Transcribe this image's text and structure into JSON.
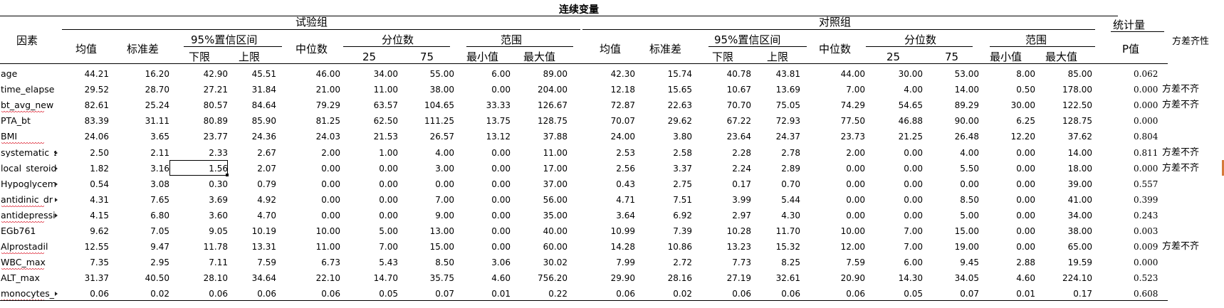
{
  "title": "连续变量",
  "groups": {
    "trial": "试验组",
    "control": "对照组",
    "stat": "统计量"
  },
  "headers": {
    "factor": "因素",
    "mean": "均值",
    "sd": "标准差",
    "ci": "95%置信区间",
    "ci_low": "下限",
    "ci_high": "上限",
    "median": "中位数",
    "quantile": "分位数",
    "q25": "25",
    "q75": "75",
    "range": "范围",
    "min": "最小值",
    "max": "最大值",
    "p": "P值",
    "var_homo": "方差齐性"
  },
  "rows": [
    {
      "name": "age",
      "t": [
        "44.21",
        "16.20",
        "42.90",
        "45.51",
        "46.00",
        "34.00",
        "55.00",
        "6.00",
        "89.00"
      ],
      "c": [
        "42.30",
        "15.74",
        "40.78",
        "43.81",
        "44.00",
        "30.00",
        "53.00",
        "8.00",
        "85.00"
      ],
      "p": "0.062",
      "note": ""
    },
    {
      "name": "time_elapse",
      "t": [
        "29.52",
        "28.70",
        "27.21",
        "31.84",
        "21.00",
        "11.00",
        "38.00",
        "0.00",
        "204.00"
      ],
      "c": [
        "12.18",
        "15.65",
        "10.67",
        "13.69",
        "7.00",
        "4.00",
        "14.00",
        "0.50",
        "178.00"
      ],
      "p": "0.000",
      "note": "方差不齐"
    },
    {
      "name": "bt_avg_new",
      "t": [
        "82.61",
        "25.24",
        "80.57",
        "84.64",
        "79.29",
        "63.57",
        "104.65",
        "33.33",
        "126.67"
      ],
      "c": [
        "72.87",
        "22.63",
        "70.70",
        "75.05",
        "74.29",
        "54.65",
        "89.29",
        "30.00",
        "122.50"
      ],
      "p": "0.000",
      "note": "方差不齐"
    },
    {
      "name": "PTA_bt",
      "t": [
        "83.39",
        "31.11",
        "80.89",
        "85.90",
        "81.25",
        "62.50",
        "111.25",
        "13.75",
        "128.75"
      ],
      "c": [
        "70.07",
        "29.62",
        "67.22",
        "72.93",
        "77.50",
        "46.88",
        "90.00",
        "6.25",
        "128.75"
      ],
      "p": "0.000",
      "note": ""
    },
    {
      "name": "BMI",
      "t": [
        "24.06",
        "3.65",
        "23.77",
        "24.36",
        "24.03",
        "21.53",
        "26.57",
        "13.12",
        "37.88"
      ],
      "c": [
        "24.00",
        "3.80",
        "23.64",
        "24.37",
        "23.73",
        "21.25",
        "26.48",
        "12.20",
        "37.62"
      ],
      "p": "0.804",
      "note": ""
    },
    {
      "name": "systematic_s",
      "t": [
        "2.50",
        "2.11",
        "2.33",
        "2.67",
        "2.00",
        "1.00",
        "4.00",
        "0.00",
        "11.00"
      ],
      "c": [
        "2.53",
        "2.58",
        "2.28",
        "2.78",
        "2.00",
        "0.00",
        "4.00",
        "0.00",
        "14.00"
      ],
      "p": "0.811",
      "note": "方差不齐"
    },
    {
      "name": "local_steroid",
      "t": [
        "1.82",
        "3.16",
        "1.56",
        "2.07",
        "0.00",
        "0.00",
        "3.00",
        "0.00",
        "17.00"
      ],
      "c": [
        "2.56",
        "3.37",
        "2.24",
        "2.89",
        "0.00",
        "0.00",
        "5.50",
        "0.00",
        "18.00"
      ],
      "p": "0.000",
      "note": "方差不齐"
    },
    {
      "name": "Hypoglycem",
      "t": [
        "0.54",
        "3.08",
        "0.30",
        "0.79",
        "0.00",
        "0.00",
        "0.00",
        "0.00",
        "37.00"
      ],
      "c": [
        "0.43",
        "2.75",
        "0.17",
        "0.70",
        "0.00",
        "0.00",
        "0.00",
        "0.00",
        "39.00"
      ],
      "p": "0.557",
      "note": ""
    },
    {
      "name": "antidinic_dr",
      "t": [
        "4.31",
        "7.65",
        "3.69",
        "4.92",
        "0.00",
        "0.00",
        "7.00",
        "0.00",
        "56.00"
      ],
      "c": [
        "4.71",
        "7.51",
        "3.99",
        "5.44",
        "0.00",
        "0.00",
        "8.50",
        "0.00",
        "41.00"
      ],
      "p": "0.399",
      "note": ""
    },
    {
      "name": "antidepressi",
      "t": [
        "4.15",
        "6.80",
        "3.60",
        "4.70",
        "0.00",
        "0.00",
        "9.00",
        "0.00",
        "35.00"
      ],
      "c": [
        "3.64",
        "6.92",
        "2.97",
        "4.30",
        "0.00",
        "0.00",
        "5.00",
        "0.00",
        "34.00"
      ],
      "p": "0.243",
      "note": ""
    },
    {
      "name": "EGb761",
      "t": [
        "9.62",
        "7.05",
        "9.05",
        "10.19",
        "10.00",
        "5.00",
        "13.00",
        "0.00",
        "40.00"
      ],
      "c": [
        "10.99",
        "7.39",
        "10.28",
        "11.70",
        "10.00",
        "7.00",
        "15.00",
        "0.00",
        "38.00"
      ],
      "p": "0.003",
      "note": ""
    },
    {
      "name": "Alprostadil",
      "t": [
        "12.55",
        "9.47",
        "11.78",
        "13.31",
        "11.00",
        "7.00",
        "15.00",
        "0.00",
        "60.00"
      ],
      "c": [
        "14.28",
        "10.86",
        "13.23",
        "15.32",
        "12.00",
        "7.00",
        "19.00",
        "0.00",
        "65.00"
      ],
      "p": "0.009",
      "note": "方差不齐"
    },
    {
      "name": "WBC_max",
      "t": [
        "7.35",
        "2.95",
        "7.11",
        "7.59",
        "6.73",
        "5.43",
        "8.50",
        "3.06",
        "30.02"
      ],
      "c": [
        "7.99",
        "2.72",
        "7.73",
        "8.25",
        "7.59",
        "6.00",
        "9.45",
        "2.88",
        "19.59"
      ],
      "p": "0.000",
      "note": ""
    },
    {
      "name": "ALT_max",
      "t": [
        "31.37",
        "40.50",
        "28.10",
        "34.64",
        "22.10",
        "14.70",
        "35.75",
        "4.60",
        "756.20"
      ],
      "c": [
        "29.90",
        "28.16",
        "27.19",
        "32.61",
        "20.90",
        "14.30",
        "34.05",
        "4.60",
        "224.10"
      ],
      "p": "0.523",
      "note": ""
    },
    {
      "name": "monocytes_",
      "t": [
        "0.06",
        "0.02",
        "0.06",
        "0.06",
        "0.06",
        "0.05",
        "0.07",
        "0.01",
        "0.22"
      ],
      "c": [
        "0.06",
        "0.02",
        "0.06",
        "0.06",
        "0.06",
        "0.05",
        "0.07",
        "0.01",
        "0.17"
      ],
      "p": "0.608",
      "note": ""
    }
  ],
  "colors": {
    "grid": "#000000",
    "spellcheck": "#dd2222",
    "edge_marker": "#d57a3a"
  }
}
